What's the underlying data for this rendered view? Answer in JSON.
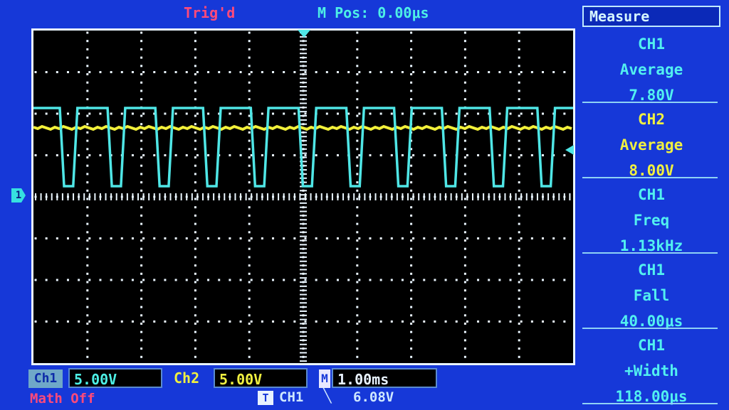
{
  "header": {
    "trigger_status": "Trig'd",
    "m_pos": "M Pos: 0.00μs"
  },
  "channel_marker": "1",
  "measure_panel": {
    "title": "Measure",
    "items": [
      {
        "channel": "CH1",
        "type": "Average",
        "value": "7.80V",
        "color": "#52f0f0"
      },
      {
        "channel": "CH2",
        "type": "Average",
        "value": "8.00V",
        "color": "#f0f040"
      },
      {
        "channel": "CH1",
        "type": "Freq",
        "value": "1.13kHz",
        "color": "#52f0f0"
      },
      {
        "channel": "CH1",
        "type": "Fall",
        "value": "40.00μs",
        "color": "#52f0f0"
      },
      {
        "channel": "CH1",
        "type": "+Width",
        "value": "118.00μs",
        "color": "#52f0f0"
      }
    ]
  },
  "footer": {
    "ch1_label": "Ch1",
    "ch1_scale": "5.00V",
    "ch2_label": "Ch2",
    "ch2_scale": "5.00V",
    "m_label": "M",
    "time_scale": "1.00ms",
    "math_status": "Math Off",
    "trigger_icon": "T",
    "trigger_source": "CH1",
    "trigger_edge_icon": "falling-edge-icon",
    "trigger_edge_glyph": "╲",
    "trigger_level": "6.08V"
  },
  "colors": {
    "background": "#1638d8",
    "grid": "#eaf6ff",
    "ch1_trace": "#4fe6e6",
    "ch2_trace": "#f2f03a",
    "trigger_red": "#ff4a7a"
  }
}
